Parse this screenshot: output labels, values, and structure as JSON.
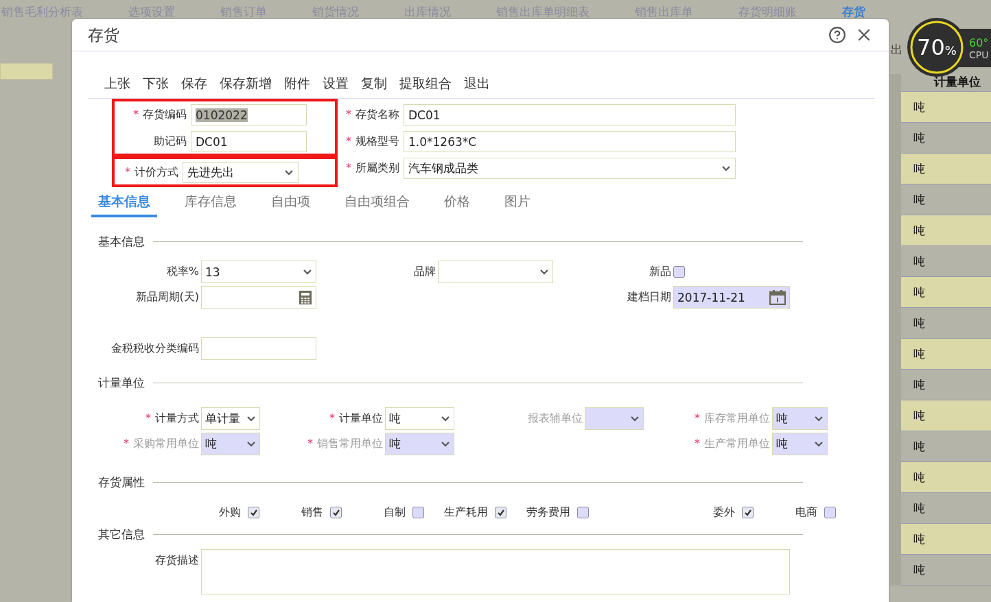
{
  "background": {
    "tabs": [
      {
        "label": "销售毛利分析表",
        "selected": false
      },
      {
        "label": "选项设置",
        "selected": false
      },
      {
        "label": "销售订单",
        "selected": false
      },
      {
        "label": "销货情况",
        "selected": false
      },
      {
        "label": "出库情况",
        "selected": false
      },
      {
        "label": "销售出库单明细表",
        "selected": false
      },
      {
        "label": "销售出库单",
        "selected": false
      },
      {
        "label": "存货明细账",
        "selected": false
      },
      {
        "label": "存货",
        "selected": true
      }
    ],
    "toolbar_fragment": "出",
    "table": {
      "column": "计量单位",
      "rows": [
        "吨",
        "吨",
        "吨",
        "吨",
        "吨",
        "吨",
        "吨",
        "吨",
        "吨",
        "吨",
        "吨",
        "吨",
        "吨",
        "吨",
        "吨",
        "吨"
      ]
    },
    "cpu_widget": {
      "usage": "70",
      "unit": "%",
      "temperature": "60°",
      "label": "CPU"
    }
  },
  "dialog": {
    "title": "存货",
    "toolbar": [
      "上张",
      "下张",
      "保存",
      "保存新增",
      "附件",
      "设置",
      "复制",
      "提取组合",
      "退出"
    ],
    "left_groups": [
      {
        "highlighted": true,
        "fields": [
          {
            "label": "存货编码",
            "mark": "*",
            "kind": "text",
            "value": "0102022",
            "selected": true
          },
          {
            "label": "助记码",
            "kind": "text",
            "value": "DC01",
            "selected": false
          }
        ]
      },
      {
        "highlighted": true,
        "fields": [
          {
            "label": "计价方式",
            "mark": "*",
            "kind": "select",
            "value": "先进先出",
            "selected": false
          }
        ]
      }
    ],
    "right_fields": [
      {
        "label": "存货名称",
        "mark": "*",
        "kind": "text",
        "value": "DC01"
      },
      {
        "label": "规格型号",
        "mark": "*",
        "kind": "text",
        "value": "1.0*1263*C"
      },
      {
        "label": "所屬类别",
        "mark": "*",
        "kind": "select",
        "value": "汽车钢成品类"
      }
    ],
    "tabs": [
      {
        "label": "基本信息",
        "selected": true
      },
      {
        "label": "库存信息",
        "selected": false
      },
      {
        "label": "自由项",
        "selected": false
      },
      {
        "label": "自由项组合",
        "selected": false
      },
      {
        "label": "价格",
        "selected": false
      },
      {
        "label": "图片",
        "selected": false
      }
    ],
    "basic": {
      "title": "基本信息",
      "rows": [
        {
          "left": {
            "label": "税率%",
            "kind": "select",
            "value": "13"
          },
          "middle": {
            "label": "品牌",
            "kind": "select"
          },
          "right": {
            "label": "新品",
            "kind": "checkbox",
            "checked": false
          }
        },
        {
          "left": {
            "label": "新品周期(天)",
            "kind": "calc"
          },
          "right": {
            "label": "建档日期",
            "kind": "date",
            "value": "2017-11-21"
          }
        },
        {
          "left": {
            "label": "金税税收分类编码",
            "kind": "text"
          }
        }
      ]
    },
    "units": {
      "title": "计量单位",
      "rows": [
        {
          "first": {
            "label": "计量方式",
            "mark": "*",
            "disabled": false,
            "value": "单计量"
          },
          "second": {
            "label": "计量单位",
            "mark": "*",
            "disabled": false,
            "value": "吨"
          },
          "third": {
            "label": "报表辅单位",
            "disabled": true
          },
          "fourth": {
            "label": "库存常用单位",
            "mark": "*",
            "disabled": true,
            "value": "吨"
          }
        },
        {
          "first": {
            "label": "采购常用单位",
            "mark": "*",
            "disabled": true,
            "value": "吨"
          },
          "second": {
            "label": "销售常用单位",
            "mark": "*",
            "disabled": true,
            "value": "吨"
          },
          "fourth": {
            "label": "生产常用单位",
            "mark": "*",
            "disabled": true,
            "value": "吨"
          }
        }
      ]
    },
    "attributes": {
      "title": "存货属性",
      "groups": [
        {
          "items": [
            {
              "label": "外购",
              "checked": true
            },
            {
              "label": "销售",
              "checked": true
            },
            {
              "label": "自制",
              "checked": false
            },
            {
              "label": "生产耗用",
              "checked": true
            },
            {
              "label": "劳务费用",
              "checked": false
            }
          ]
        },
        {
          "items": [
            {
              "label": "委外",
              "checked": true
            },
            {
              "label": "电商",
              "checked": false
            }
          ]
        }
      ]
    },
    "other": {
      "title": "其它信息",
      "description_label": "存货描述"
    }
  }
}
